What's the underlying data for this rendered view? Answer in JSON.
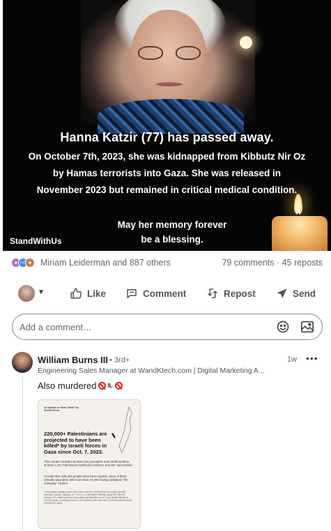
{
  "post_image": {
    "headline": "Hanna Katzir (77) has passed away.",
    "body_lines": [
      "On October 7th, 2023, she was kidnapped from Kibbutz Nir Oz",
      "by Hamas terrorists into Gaza.  She was released in",
      "November 2023 but remained in critical medical condition."
    ],
    "memory_lines": [
      "May her memory forever",
      "be a blessing."
    ],
    "brand": "StandWithUs"
  },
  "social": {
    "reactors": "Miriam Leiderman and 887 others",
    "counts": "79 comments · 45 reposts",
    "reaction_icons": [
      "celebrate-icon",
      "like-icon",
      "love-icon"
    ]
  },
  "actions": {
    "like": "Like",
    "comment": "Comment",
    "repost": "Repost",
    "send": "Send"
  },
  "comment_box": {
    "placeholder": "Add a comment…"
  },
  "comment": {
    "author": "William Burns III",
    "degree": "• 3rd+",
    "time": "1w",
    "more": "•••",
    "headline": "Engineering Sales Manager at WandKtech.com | Digital Marketing A...",
    "text": "Also murdered",
    "flag_label": "IL",
    "attachment": {
      "kicker": "An Update on Gaza: What You Should Know",
      "title": "220,000+ Palestinians are projected to have been killed* by Israeli forces in Gaza since Oct. 7, 2023.",
      "p1": "This number includes at least 191 journalists and media workers, at least 1,151 Palestinian healthcare workers, and 337 aid workers.",
      "p2": "At least than 105,000 people have been injured, many of them critically wounded, with more than 24,000 having sustained \"life-changing\" injuries.",
      "p3": "*This number includes those killed either directly or indirectly from bombing, gunfire, starvation, famine, disease, etc. This is a conservative estimate using The Lancet's indicator. The total number of those killed and identified by the Gaza Health Ministry is 40,205 people, including at least 17,029 children, with more than 10,000 reported missing beneath the rubble."
    }
  },
  "colors": {
    "text_primary": "#1d1d1d",
    "text_secondary": "#666666",
    "border": "#8c8c8c",
    "prohibited_red": "#e02020"
  }
}
